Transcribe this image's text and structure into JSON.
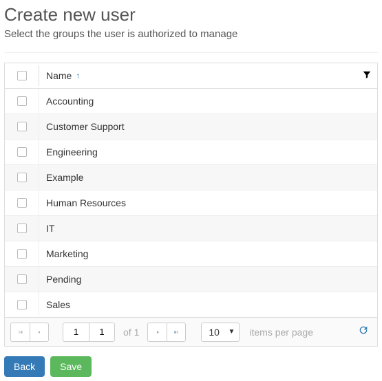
{
  "header": {
    "title": "Create new user",
    "subtitle": "Select the groups the user is authorized to manage"
  },
  "grid": {
    "column_label": "Name",
    "sort_indicator": "↑",
    "rows": [
      {
        "name": "Accounting"
      },
      {
        "name": "Customer Support"
      },
      {
        "name": "Engineering"
      },
      {
        "name": "Example"
      },
      {
        "name": "Human Resources"
      },
      {
        "name": "IT"
      },
      {
        "name": "Marketing"
      },
      {
        "name": "Pending"
      },
      {
        "name": "Sales"
      }
    ]
  },
  "pager": {
    "page": "1",
    "page2": "1",
    "of_label": "of",
    "total_pages": "1",
    "page_size": "10",
    "items_per_page_label": "items per page"
  },
  "actions": {
    "back": "Back",
    "save": "Save"
  }
}
